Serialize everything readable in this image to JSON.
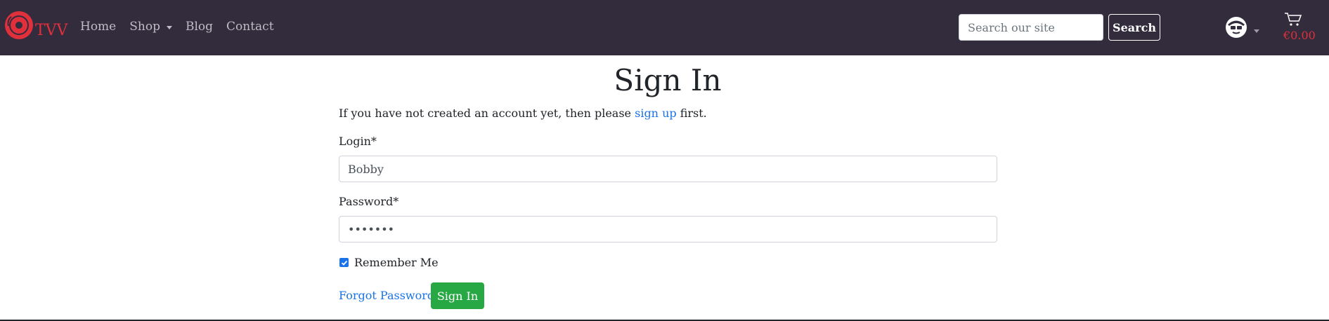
{
  "navbar": {
    "brand": "TVV",
    "links": [
      {
        "label": "Home"
      },
      {
        "label": "Shop",
        "has_dropdown": true
      },
      {
        "label": "Blog"
      },
      {
        "label": "Contact"
      }
    ],
    "search": {
      "placeholder": "Search our site",
      "button_label": "Search"
    },
    "account_icon": "user-icon",
    "cart": {
      "icon": "cart-icon",
      "total": "€0.00"
    }
  },
  "signin": {
    "title": "Sign In",
    "intro_before": "If you have not created an account yet, then please ",
    "intro_link": "sign up",
    "intro_after": " first.",
    "login_label": "Login*",
    "login_value": "Bobby",
    "password_label": "Password*",
    "password_value": "•••••••",
    "remember_label": "Remember Me",
    "remember_checked": true,
    "forgot_label": "Forgot Password?",
    "submit_label": "Sign In"
  },
  "colors": {
    "navbar_bg": "#322c3c",
    "brand": "#e0303c",
    "link": "#1a73e8",
    "submit_bg": "#28a745"
  }
}
